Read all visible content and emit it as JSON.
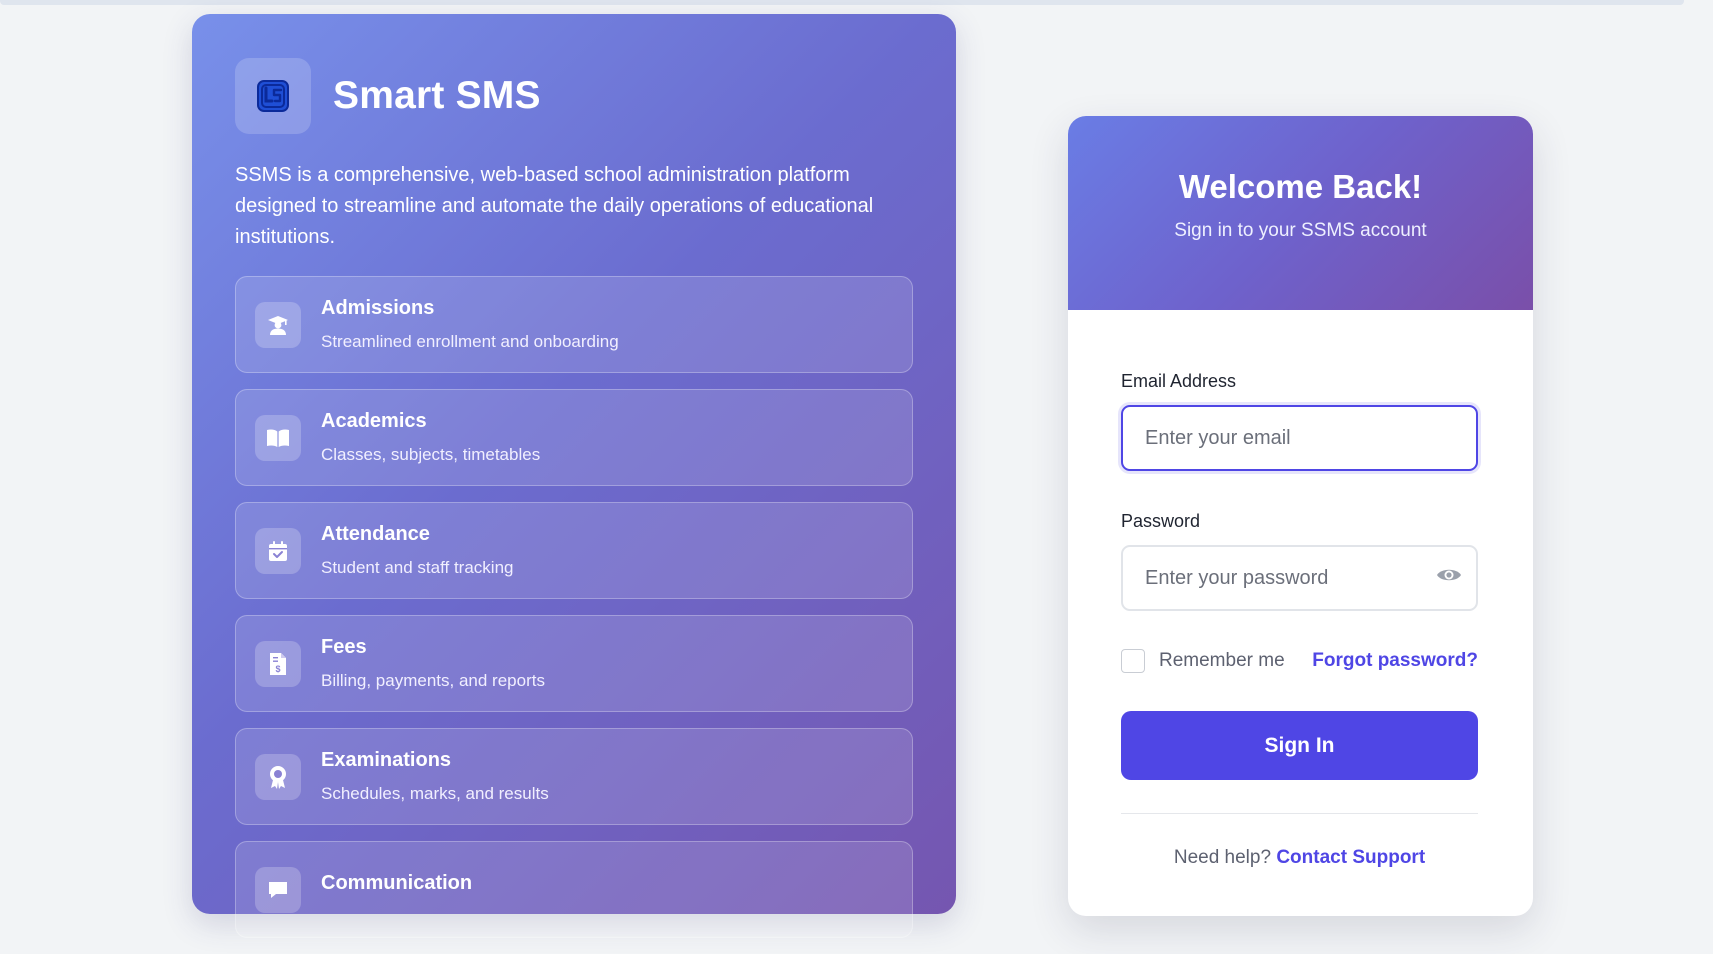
{
  "brand": {
    "name": "Smart SMS",
    "description": "SSMS is a comprehensive, web-based school administration platform designed to streamline and automate the daily operations of educational institutions."
  },
  "features": [
    {
      "title": "Admissions",
      "description": "Streamlined enrollment and onboarding",
      "icon": "graduate-icon"
    },
    {
      "title": "Academics",
      "description": "Classes, subjects, timetables",
      "icon": "book-icon"
    },
    {
      "title": "Attendance",
      "description": "Student and staff tracking",
      "icon": "calendar-check-icon"
    },
    {
      "title": "Fees",
      "description": "Billing, payments, and reports",
      "icon": "invoice-dollar-icon"
    },
    {
      "title": "Examinations",
      "description": "Schedules, marks, and results",
      "icon": "award-icon"
    },
    {
      "title": "Communication",
      "description": "",
      "icon": "message-icon"
    }
  ],
  "login": {
    "title": "Welcome Back!",
    "subtitle": "Sign in to your SSMS account",
    "email_label": "Email Address",
    "email_placeholder": "Enter your email",
    "password_label": "Password",
    "password_placeholder": "Enter your password",
    "remember_label": "Remember me",
    "forgot_label": "Forgot password?",
    "signin_label": "Sign In",
    "help_text": "Need help?",
    "support_label": "Contact Support"
  },
  "colors": {
    "accent": "#4f46e5",
    "panel_gradient_start": "#7890ea",
    "panel_gradient_end": "#7556b0",
    "background": "#f2f4f6"
  }
}
